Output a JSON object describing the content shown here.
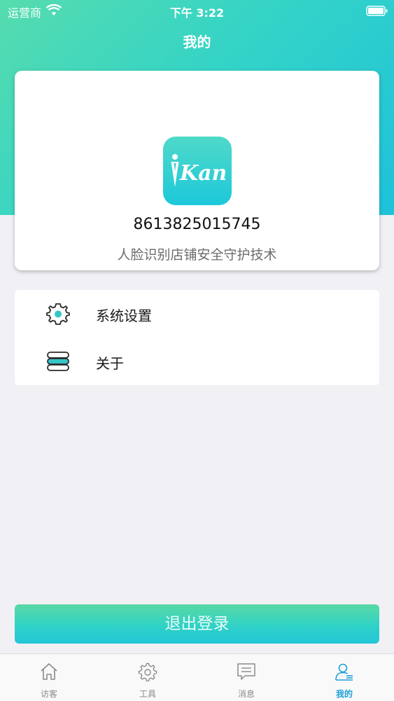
{
  "status_bar": {
    "carrier": "运营商",
    "time": "下午 3:22"
  },
  "nav": {
    "title": "我的"
  },
  "profile": {
    "logo_text": "Kan",
    "phone": "8613825015745",
    "tagline": "人脸识别店铺安全守护技术"
  },
  "menu": {
    "items": [
      {
        "label": "系统设置",
        "icon": "gear-icon"
      },
      {
        "label": "关于",
        "icon": "database-icon"
      }
    ]
  },
  "actions": {
    "logout_label": "退出登录"
  },
  "tabs": [
    {
      "label": "访客",
      "icon": "home-icon",
      "active": false
    },
    {
      "label": "工具",
      "icon": "gear-icon",
      "active": false
    },
    {
      "label": "消息",
      "icon": "message-icon",
      "active": false
    },
    {
      "label": "我的",
      "icon": "user-icon",
      "active": true
    }
  ],
  "colors": {
    "accent": "#1e9fd6",
    "gradient_start": "#56dcae",
    "gradient_end": "#1ec2da",
    "background": "#f1f0f5"
  }
}
